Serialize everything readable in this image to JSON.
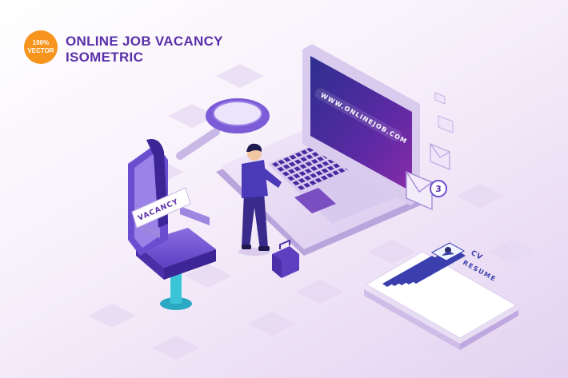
{
  "badge": {
    "line1": "100%",
    "line2": "VECTOR"
  },
  "title": {
    "line1": "ONLINE JOB VACANCY",
    "line2": "ISOMETRIC"
  },
  "laptop": {
    "url": "WWW.ONLINEJOB.COM"
  },
  "chair": {
    "sign": "VACANCY"
  },
  "mail": {
    "badge_count": "3"
  },
  "resume": {
    "line1": "CV",
    "line2": "RESUME"
  },
  "colors": {
    "accent": "#f7941d",
    "brand": "#5a2fa8",
    "screen": "#4a2aa0",
    "resume_lines": "#3b3fae"
  }
}
